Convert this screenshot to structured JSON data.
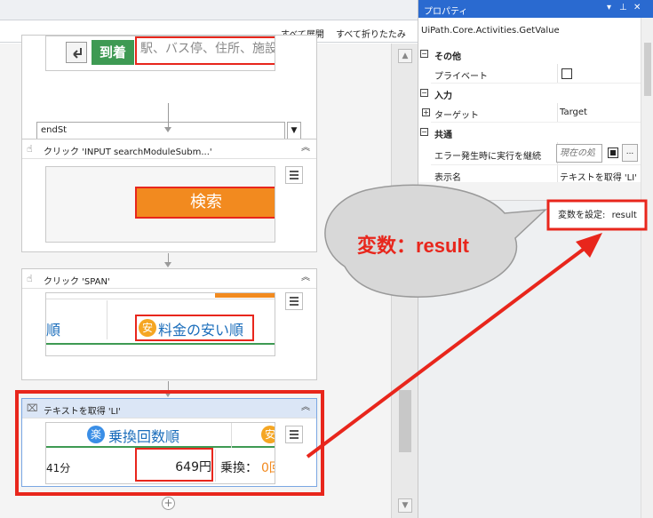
{
  "designer": {
    "toolbar": {
      "expand_all": "すべて展開",
      "collapse_all": "すべて折りたたみ"
    },
    "top_activity": {
      "button_label": "到着",
      "input_placeholder": "駅、バス停、住所、施設",
      "dropdown_value": "endSt"
    },
    "activities": [
      {
        "title": "クリック 'INPUT  searchModuleSubm...'",
        "preview_button_label": "検索"
      },
      {
        "title": "クリック 'SPAN'",
        "preview_left_text": "順",
        "preview_badge": "安",
        "preview_text": "料金の安い順"
      },
      {
        "title": "テキストを取得 'LI'",
        "preview_badge": "楽",
        "preview_title": "乗換回数順",
        "preview_badge_right": "安",
        "preview_time": "41分",
        "preview_price": "649円",
        "preview_transfer_label": "乗換：",
        "preview_transfer_value": "0回"
      }
    ]
  },
  "properties": {
    "title": "プロパティ",
    "activity_type": "UiPath.Core.Activities.GetValue",
    "rows": [
      {
        "kind": "category",
        "label": "その他",
        "expander": "⊟"
      },
      {
        "kind": "property",
        "name": "プライベート",
        "value_type": "checkbox",
        "checked": false
      },
      {
        "kind": "category",
        "label": "入力",
        "expander": "⊟"
      },
      {
        "kind": "property",
        "name": "ターゲット",
        "value": "Target",
        "expander": "⊞"
      },
      {
        "kind": "category",
        "label": "共通",
        "expander": "⊟"
      },
      {
        "kind": "property",
        "name": "エラー発生時に実行を継続",
        "value_type": "input",
        "placeholder": "現在の処"
      },
      {
        "kind": "property",
        "name": "表示名",
        "value": "テキストを取得 'LI'"
      }
    ],
    "output_row": {
      "name": "変数を設定:",
      "value": "result"
    }
  },
  "annotation": {
    "callout_text": "変数：result",
    "accent_color": "#e8261c"
  },
  "colors": {
    "uipath_orange": "#f28a1f",
    "selected_header": "#dbe6f6",
    "title_bar": "#2a6ad0",
    "nav_green": "#3e9a53",
    "link_blue": "#1a6dbb"
  }
}
